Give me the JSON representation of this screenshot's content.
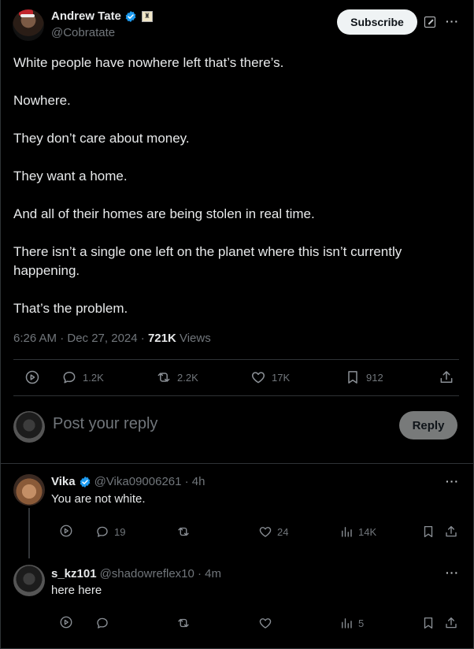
{
  "author": {
    "name": "Andrew Tate",
    "handle": "@Cobratate",
    "verified": true,
    "subscribe_label": "Subscribe"
  },
  "tweet": {
    "paragraphs": [
      "White people have nowhere left that’s there’s.",
      "Nowhere.",
      "They don’t care about money.",
      "They want a home.",
      "And all of their homes are being stolen in real time.",
      "There isn’t a single one left on the planet where this isn’t currently happening.",
      "That’s the problem."
    ],
    "time": "6:26 AM · Dec 27, 2024 · ",
    "views_count": "721K",
    "views_label": " Views"
  },
  "actions": {
    "replies": "1.2K",
    "reposts": "2.2K",
    "likes": "17K",
    "bookmarks": "912"
  },
  "composer": {
    "placeholder": "Post your reply",
    "reply_label": "Reply"
  },
  "replies": [
    {
      "name": "Vika",
      "verified": true,
      "handle": "@Vika09006261 · 4h",
      "text": "You are not white.",
      "replies": "19",
      "reposts": "",
      "likes": "24",
      "views": "14K"
    },
    {
      "name": "s_kz101",
      "verified": false,
      "handle": "@shadowreflex10 · 4m",
      "text": "here here",
      "replies": "",
      "reposts": "",
      "likes": "",
      "views": "5"
    }
  ],
  "colors": {
    "background": "#000000",
    "text": "#e7e9ea",
    "muted": "#71767b",
    "divider": "#2f3336",
    "verified": "#1d9bf0"
  }
}
